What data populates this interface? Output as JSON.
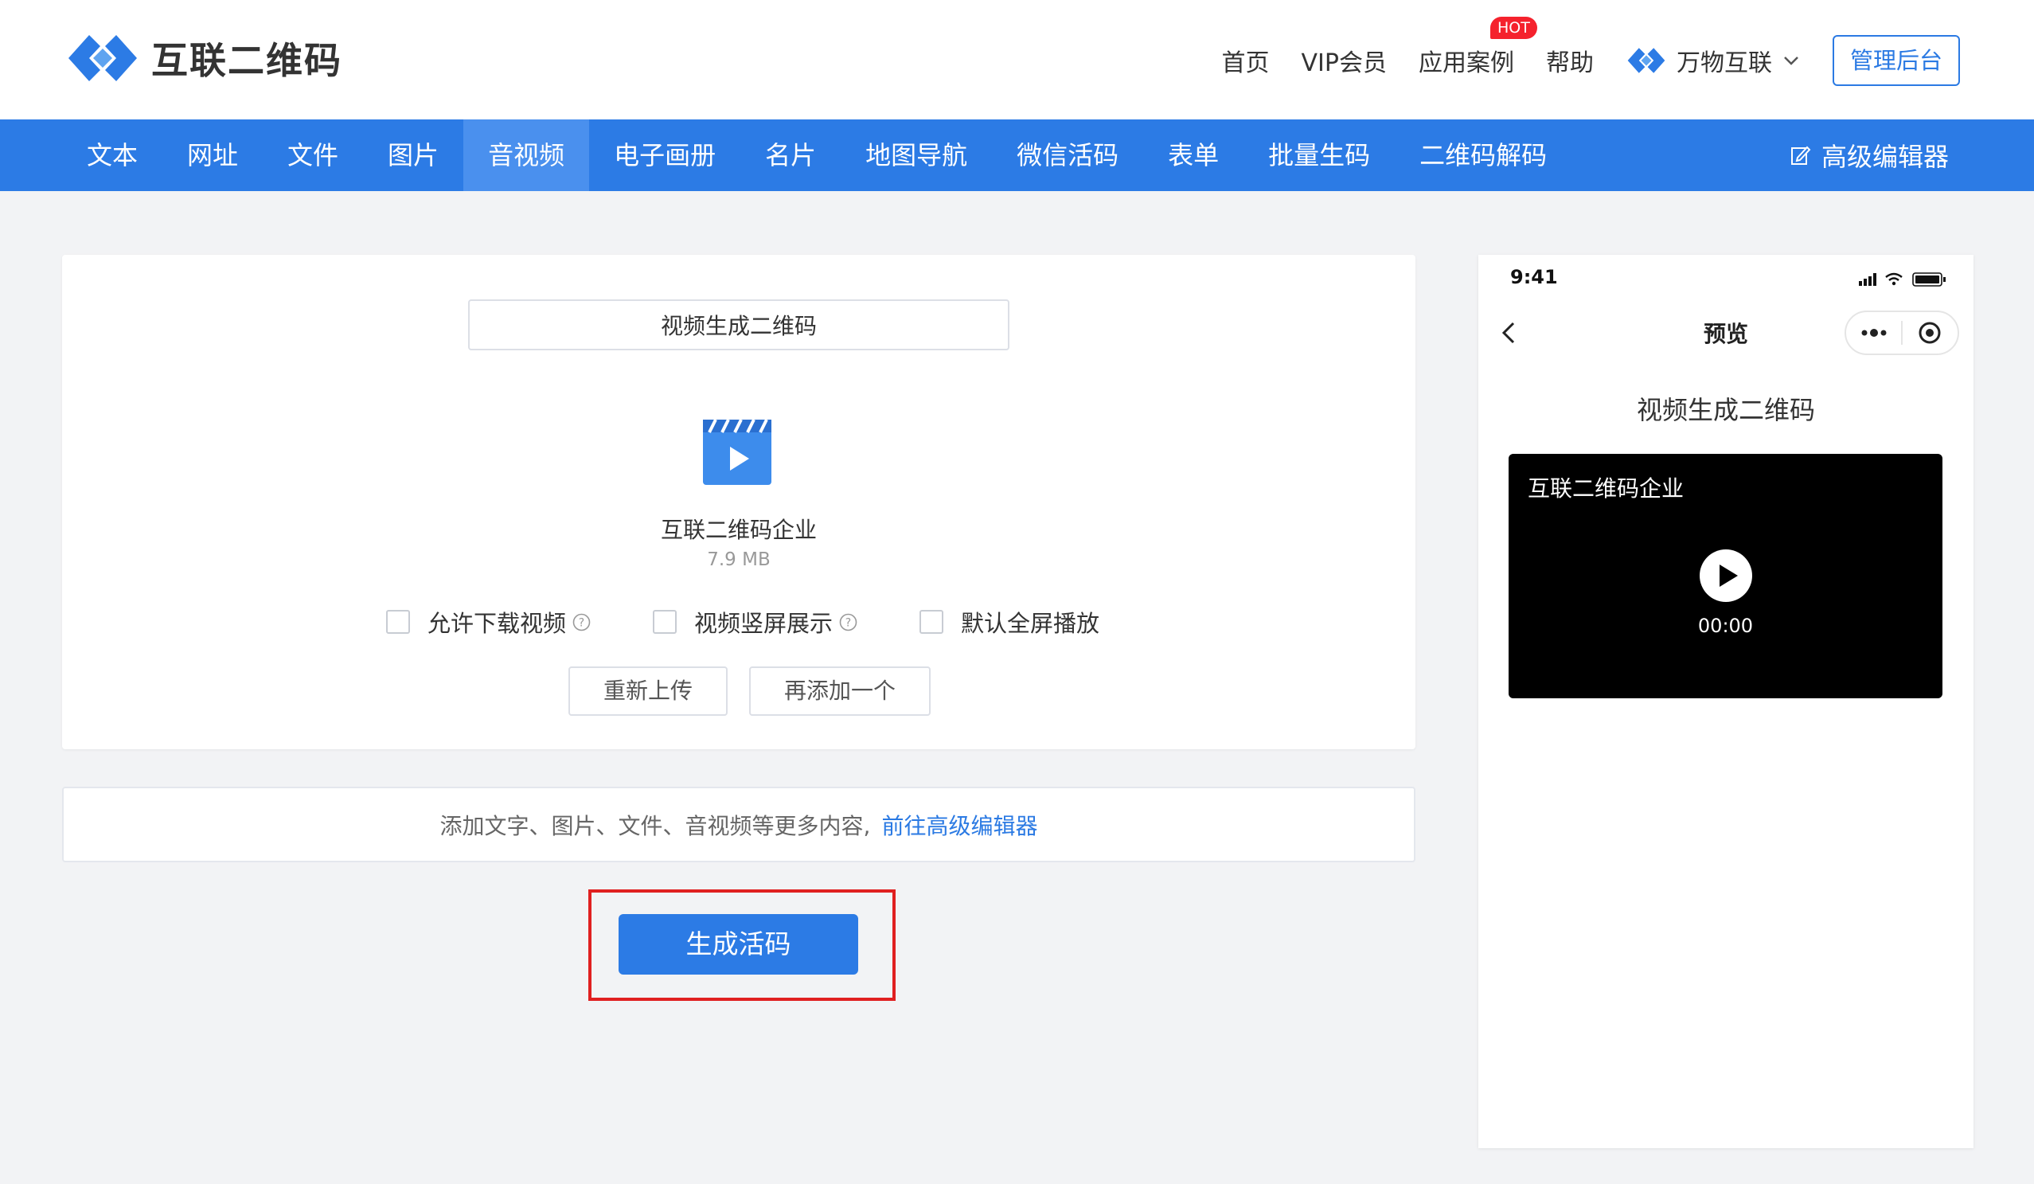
{
  "brand": {
    "name": "互联二维码",
    "accent": "#2c7be5"
  },
  "topnav": {
    "items": [
      "首页",
      "VIP会员",
      "应用案例",
      "帮助"
    ],
    "hot_badge": "HOT",
    "wanwu_label": "万物互联",
    "admin_label": "管理后台"
  },
  "bluenav": {
    "items": [
      "文本",
      "网址",
      "文件",
      "图片",
      "音视频",
      "电子画册",
      "名片",
      "地图导航",
      "微信活码",
      "表单",
      "批量生码",
      "二维码解码"
    ],
    "active": "音视频",
    "editor_label": "高级编辑器"
  },
  "editor": {
    "title_value": "视频生成二维码",
    "file_name": "互联二维码企业",
    "file_size": "7.9 MB",
    "options": [
      {
        "label": "允许下载视频",
        "checked": false,
        "help": true
      },
      {
        "label": "视频竖屏展示",
        "checked": false,
        "help": true
      },
      {
        "label": "默认全屏播放",
        "checked": false,
        "help": false
      }
    ],
    "reupload_label": "重新上传",
    "add_another_label": "再添加一个"
  },
  "tip": {
    "text": "添加文字、图片、文件、音视频等更多内容,",
    "link": "前往高级编辑器"
  },
  "generate_label": "生成活码",
  "phone": {
    "time": "9:41",
    "nav_title": "预览",
    "heading": "视频生成二维码",
    "video_title": "互联二维码企业",
    "video_time": "00:00"
  }
}
